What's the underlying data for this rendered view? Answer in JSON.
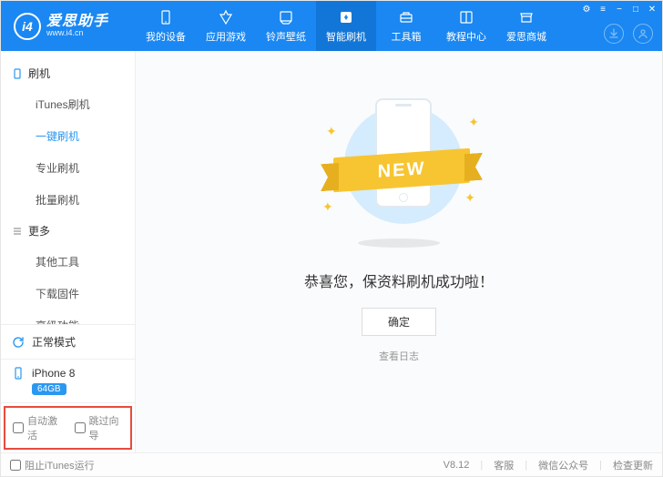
{
  "brand": {
    "name": "爱思助手",
    "url": "www.i4.cn",
    "logo_text": "i4"
  },
  "header_tabs": [
    {
      "label": "我的设备",
      "icon": "phone"
    },
    {
      "label": "应用游戏",
      "icon": "app"
    },
    {
      "label": "铃声壁纸",
      "icon": "music"
    },
    {
      "label": "智能刷机",
      "icon": "flash"
    },
    {
      "label": "工具箱",
      "icon": "toolbox"
    },
    {
      "label": "教程中心",
      "icon": "book"
    },
    {
      "label": "爱思商城",
      "icon": "shop"
    }
  ],
  "active_tab_index": 3,
  "sidebar": {
    "groups": [
      {
        "title": "刷机",
        "icon": "phone",
        "items": [
          "iTunes刷机",
          "一键刷机",
          "专业刷机",
          "批量刷机"
        ],
        "active_index": 1
      },
      {
        "title": "更多",
        "icon": "more",
        "items": [
          "其他工具",
          "下载固件",
          "高级功能"
        ],
        "active_index": -1
      }
    ],
    "mode": {
      "label": "正常模式"
    },
    "device": {
      "name": "iPhone 8",
      "storage": "64GB"
    }
  },
  "main": {
    "ribbon_text": "NEW",
    "success_text": "恭喜您，保资料刷机成功啦！",
    "ok_button": "确定",
    "view_log": "查看日志"
  },
  "footer_options": {
    "auto_activate": "自动激活",
    "skip_wizard": "跳过向导"
  },
  "statusbar": {
    "block_itunes": "阻止iTunes运行",
    "version": "V8.12",
    "support": "客服",
    "wechat": "微信公众号",
    "check_update": "检查更新"
  }
}
